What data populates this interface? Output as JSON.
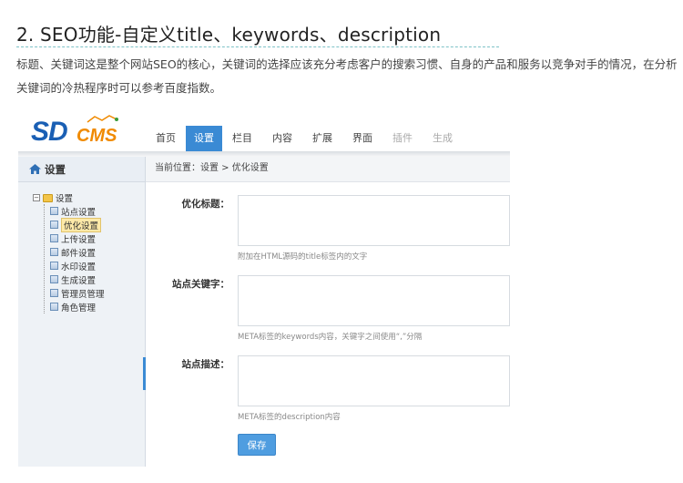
{
  "article": {
    "title": "2. SEO功能-自定义title、keywords、description",
    "description": "标题、关键词这是整个网站SEO的核心，关键词的选择应该充分考虑客户的搜索习惯、自身的产品和服务以竞争对手的情况，在分析关键词的冷热程序时可以参考百度指数。"
  },
  "app": {
    "logo_sd": "SD",
    "logo_cms": "CMS",
    "brand_color": "#1a5fb4",
    "accent_color": "#3a8ad4"
  },
  "topnav": {
    "tabs": [
      {
        "label": "首页"
      },
      {
        "label": "设置"
      },
      {
        "label": "栏目"
      },
      {
        "label": "内容"
      },
      {
        "label": "扩展"
      },
      {
        "label": "界面"
      },
      {
        "label": "插件"
      },
      {
        "label": "生成"
      }
    ],
    "active": "设置"
  },
  "sidebar": {
    "title": "设置",
    "tree_root": "设置",
    "items": [
      {
        "label": "站点设置"
      },
      {
        "label": "优化设置"
      },
      {
        "label": "上传设置"
      },
      {
        "label": "邮件设置"
      },
      {
        "label": "水印设置"
      },
      {
        "label": "生成设置"
      },
      {
        "label": "管理员管理"
      },
      {
        "label": "角色管理"
      }
    ],
    "selected": "优化设置"
  },
  "breadcrumb": "当前位置：设置 > 优化设置",
  "form": {
    "fields": [
      {
        "label": "优化标题：",
        "value": "",
        "hint": "附加在HTML源码的title标签内的文字"
      },
      {
        "label": "站点关键字：",
        "value": "",
        "hint": "META标签的keywords内容，关键字之间使用“,”分隔"
      },
      {
        "label": "站点描述：",
        "value": "",
        "hint": "META标签的description内容"
      }
    ],
    "save_label": "保存"
  }
}
